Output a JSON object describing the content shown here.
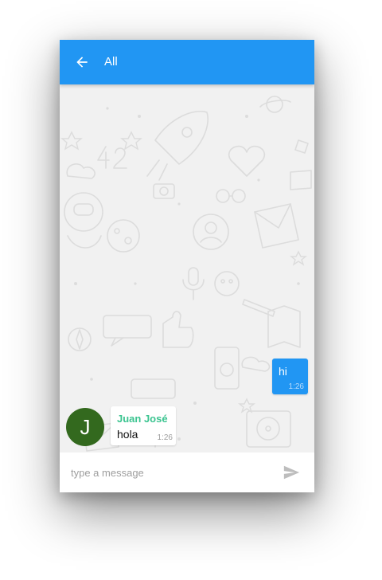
{
  "header": {
    "title": "All",
    "back_icon": "arrow-left-icon",
    "background_color": "#2196f3"
  },
  "messages": {
    "outgoing": {
      "text": "hi",
      "time": "1:26",
      "bubble_color": "#2196f3"
    },
    "incoming": {
      "avatar_initial": "J",
      "avatar_color": "#33691e",
      "sender": "Juan José",
      "sender_color": "#3bc490",
      "text": "hola",
      "time": "1:26"
    }
  },
  "composer": {
    "placeholder": "type a message",
    "value": "",
    "send_icon": "send-icon"
  }
}
